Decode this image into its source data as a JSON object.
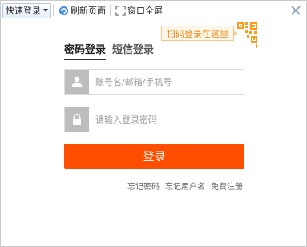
{
  "toolbar": {
    "quick_login": "快速登录",
    "refresh": "刷新页面",
    "fullscreen": "窗口全屏"
  },
  "tabs": [
    {
      "label": "密码登录",
      "active": true
    },
    {
      "label": "短信登录",
      "active": false
    }
  ],
  "qr_tip": "扫码登录在这里",
  "username": {
    "placeholder": "账号名/邮箱/手机号",
    "value": ""
  },
  "password": {
    "placeholder": "请输入登录密码",
    "value": ""
  },
  "login_button": "登录",
  "links": {
    "forgot_password": "忘记密码",
    "forgot_username": "忘记用户名",
    "register": "免费注册"
  },
  "colors": {
    "primary": "#ff4e00",
    "qr_accent": "#ff9a1a",
    "icon_bg": "#bdbdbd"
  },
  "icons": {
    "refresh": "refresh-icon",
    "fullscreen": "fullscreen-icon",
    "close": "close-icon",
    "user": "user-icon",
    "lock": "lock-icon",
    "qr": "qr-code-icon"
  }
}
